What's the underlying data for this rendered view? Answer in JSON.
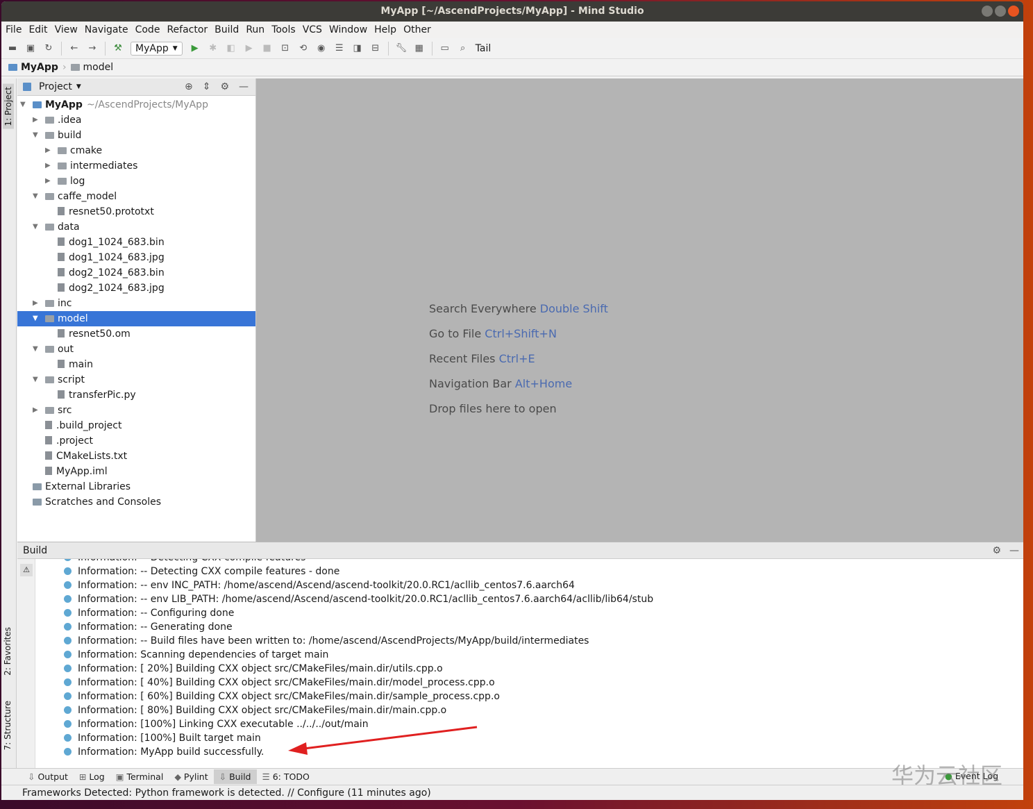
{
  "title": "MyApp [~/AscendProjects/MyApp] - Mind Studio",
  "menu": [
    "File",
    "Edit",
    "View",
    "Navigate",
    "Code",
    "Refactor",
    "Build",
    "Run",
    "Tools",
    "VCS",
    "Window",
    "Help",
    "Other"
  ],
  "toolbar": {
    "run_config": "MyApp",
    "tail": "Tail"
  },
  "breadcrumb": [
    "MyApp",
    "model"
  ],
  "left_tabs": {
    "project": "1: Project",
    "favorites": "2: Favorites",
    "structure": "7: Structure"
  },
  "project": {
    "title": "Project",
    "tree": [
      {
        "label": "MyApp",
        "hint": "~/AscendProjects/MyApp",
        "depth": 0,
        "kind": "root",
        "open": true
      },
      {
        "label": ".idea",
        "depth": 1,
        "kind": "folder",
        "open": false
      },
      {
        "label": "build",
        "depth": 1,
        "kind": "folder",
        "open": true
      },
      {
        "label": "cmake",
        "depth": 2,
        "kind": "folder",
        "open": false
      },
      {
        "label": "intermediates",
        "depth": 2,
        "kind": "folder",
        "open": false
      },
      {
        "label": "log",
        "depth": 2,
        "kind": "folder",
        "open": false
      },
      {
        "label": "caffe_model",
        "depth": 1,
        "kind": "folder",
        "open": true
      },
      {
        "label": "resnet50.prototxt",
        "depth": 2,
        "kind": "file"
      },
      {
        "label": "data",
        "depth": 1,
        "kind": "folder",
        "open": true
      },
      {
        "label": "dog1_1024_683.bin",
        "depth": 2,
        "kind": "file"
      },
      {
        "label": "dog1_1024_683.jpg",
        "depth": 2,
        "kind": "file"
      },
      {
        "label": "dog2_1024_683.bin",
        "depth": 2,
        "kind": "file"
      },
      {
        "label": "dog2_1024_683.jpg",
        "depth": 2,
        "kind": "file"
      },
      {
        "label": "inc",
        "depth": 1,
        "kind": "folder",
        "open": false
      },
      {
        "label": "model",
        "depth": 1,
        "kind": "folder",
        "open": true,
        "selected": true
      },
      {
        "label": "resnet50.om",
        "depth": 2,
        "kind": "file"
      },
      {
        "label": "out",
        "depth": 1,
        "kind": "folder",
        "open": true
      },
      {
        "label": "main",
        "depth": 2,
        "kind": "file"
      },
      {
        "label": "script",
        "depth": 1,
        "kind": "folder",
        "open": true
      },
      {
        "label": "transferPic.py",
        "depth": 2,
        "kind": "file"
      },
      {
        "label": "src",
        "depth": 1,
        "kind": "folder",
        "open": false
      },
      {
        "label": ".build_project",
        "depth": 1,
        "kind": "file"
      },
      {
        "label": ".project",
        "depth": 1,
        "kind": "file"
      },
      {
        "label": "CMakeLists.txt",
        "depth": 1,
        "kind": "file"
      },
      {
        "label": "MyApp.iml",
        "depth": 1,
        "kind": "file"
      },
      {
        "label": "External Libraries",
        "depth": 0,
        "kind": "lib"
      },
      {
        "label": "Scratches and Consoles",
        "depth": 0,
        "kind": "lib"
      }
    ]
  },
  "editor_hints": [
    {
      "text": "Search Everywhere",
      "key": "Double Shift"
    },
    {
      "text": "Go to File",
      "key": "Ctrl+Shift+N"
    },
    {
      "text": "Recent Files",
      "key": "Ctrl+E"
    },
    {
      "text": "Navigation Bar",
      "key": "Alt+Home"
    },
    {
      "text": "Drop files here to open",
      "key": ""
    }
  ],
  "build": {
    "title": "Build",
    "lines": [
      "Information: -- Detecting CXX compile features",
      "Information: -- Detecting CXX compile features - done",
      "Information: -- env INC_PATH: /home/ascend/Ascend/ascend-toolkit/20.0.RC1/acllib_centos7.6.aarch64",
      "Information: -- env LIB_PATH: /home/ascend/Ascend/ascend-toolkit/20.0.RC1/acllib_centos7.6.aarch64/acllib/lib64/stub",
      "Information: -- Configuring done",
      "Information: -- Generating done",
      "Information: -- Build files have been written to: /home/ascend/AscendProjects/MyApp/build/intermediates",
      "Information: Scanning dependencies of target main",
      "Information: [ 20%] Building CXX object src/CMakeFiles/main.dir/utils.cpp.o",
      "Information: [ 40%] Building CXX object src/CMakeFiles/main.dir/model_process.cpp.o",
      "Information: [ 60%] Building CXX object src/CMakeFiles/main.dir/sample_process.cpp.o",
      "Information: [ 80%] Building CXX object src/CMakeFiles/main.dir/main.cpp.o",
      "Information: [100%] Linking CXX executable ../../../out/main",
      "Information: [100%] Built target main",
      "Information: MyApp build successfully."
    ]
  },
  "bottom_tabs": [
    "Output",
    "Log",
    "Terminal",
    "Pylint",
    "Build",
    "6: TODO"
  ],
  "event_log": "Event Log",
  "status": "Frameworks Detected: Python framework is detected. // Configure (11 minutes ago)",
  "watermark": "华为云社区"
}
